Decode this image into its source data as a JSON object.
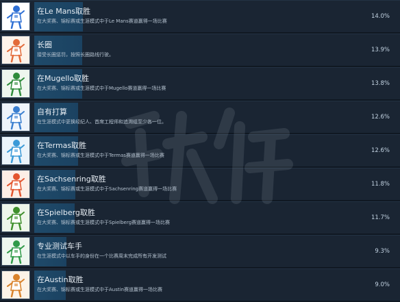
{
  "achievements": [
    {
      "title": "在Le Mans取胜",
      "desc": "在大奖赛、锦标赛或生涯模式中于Le Mans赛道赢得一场比赛",
      "percent": "14.0%",
      "percent_value": 14.0,
      "thumb_bg": "#ffffff",
      "accent": "#2d6fd4",
      "icon": "rider-trophy-icon"
    },
    {
      "title": "长圈",
      "desc": "接受长圈惩罚，按照长圈路线行驶。",
      "percent": "13.9%",
      "percent_value": 13.9,
      "thumb_bg": "#fdf3ea",
      "accent": "#e36b3a",
      "icon": "rider-icon"
    },
    {
      "title": "在Mugello取胜",
      "desc": "在大奖赛、锦标赛或生涯模式中于Mugello赛道赢得一场比赛",
      "percent": "13.8%",
      "percent_value": 13.8,
      "thumb_bg": "#eef6ee",
      "accent": "#2e8b3a",
      "icon": "rider-trophy-icon"
    },
    {
      "title": "自有打算",
      "desc": "在生涯模式中更换经纪人、首席工程师和追溯组至少各一位。",
      "percent": "12.6%",
      "percent_value": 12.6,
      "thumb_bg": "#eef4fb",
      "accent": "#3a7fd0",
      "icon": "rider-icon"
    },
    {
      "title": "在Termas取胜",
      "desc": "在大奖赛、锦标赛或生涯模式中于Termas赛道赢得一场比赛",
      "percent": "12.6%",
      "percent_value": 12.6,
      "thumb_bg": "#eaf4fb",
      "accent": "#3a9ad8",
      "icon": "rider-trophy-icon"
    },
    {
      "title": "在Sachsenring取胜",
      "desc": "在大奖赛、锦标赛或生涯模式中于Sachsenring赛道赢得一场比赛",
      "percent": "11.8%",
      "percent_value": 11.8,
      "thumb_bg": "#fdeee6",
      "accent": "#e3552f",
      "icon": "rider-trophy-icon"
    },
    {
      "title": "在Spielberg取胜",
      "desc": "在大奖赛、锦标赛或生涯模式中于Spielberg赛道赢得一场比赛",
      "percent": "11.7%",
      "percent_value": 11.7,
      "thumb_bg": "#eef6ea",
      "accent": "#3f8f2c",
      "icon": "rider-trophy-icon"
    },
    {
      "title": "专业测试车手",
      "desc": "在生涯模式中以车手的身份在一个比赛周末完成所有开发测试",
      "percent": "9.3%",
      "percent_value": 9.3,
      "thumb_bg": "#eef7ef",
      "accent": "#2f9a48",
      "icon": "rider-icon"
    },
    {
      "title": "在Austin取胜",
      "desc": "在大奖赛、锦标赛或生涯模式中于Austin赛道赢得一场比赛",
      "percent": "9.0%",
      "percent_value": 9.0,
      "thumb_bg": "#fdf3e8",
      "accent": "#d9822b",
      "icon": "rider-trophy-icon"
    }
  ]
}
